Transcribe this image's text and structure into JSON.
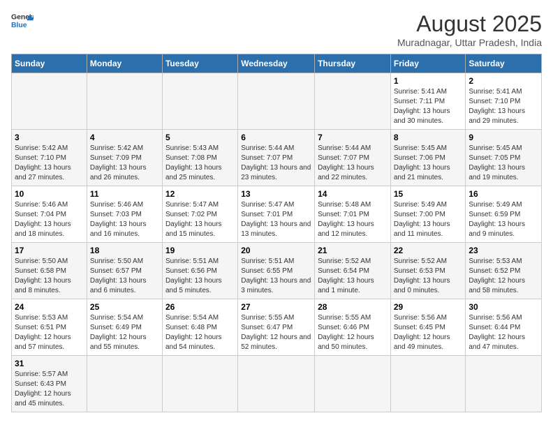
{
  "header": {
    "logo_text_regular": "General",
    "logo_text_colored": "Blue",
    "main_title": "August 2025",
    "subtitle": "Muradnagar, Uttar Pradesh, India"
  },
  "columns": [
    "Sunday",
    "Monday",
    "Tuesday",
    "Wednesday",
    "Thursday",
    "Friday",
    "Saturday"
  ],
  "weeks": [
    [
      {
        "day": "",
        "info": ""
      },
      {
        "day": "",
        "info": ""
      },
      {
        "day": "",
        "info": ""
      },
      {
        "day": "",
        "info": ""
      },
      {
        "day": "",
        "info": ""
      },
      {
        "day": "1",
        "info": "Sunrise: 5:41 AM\nSunset: 7:11 PM\nDaylight: 13 hours and 30 minutes."
      },
      {
        "day": "2",
        "info": "Sunrise: 5:41 AM\nSunset: 7:10 PM\nDaylight: 13 hours and 29 minutes."
      }
    ],
    [
      {
        "day": "3",
        "info": "Sunrise: 5:42 AM\nSunset: 7:10 PM\nDaylight: 13 hours and 27 minutes."
      },
      {
        "day": "4",
        "info": "Sunrise: 5:42 AM\nSunset: 7:09 PM\nDaylight: 13 hours and 26 minutes."
      },
      {
        "day": "5",
        "info": "Sunrise: 5:43 AM\nSunset: 7:08 PM\nDaylight: 13 hours and 25 minutes."
      },
      {
        "day": "6",
        "info": "Sunrise: 5:44 AM\nSunset: 7:07 PM\nDaylight: 13 hours and 23 minutes."
      },
      {
        "day": "7",
        "info": "Sunrise: 5:44 AM\nSunset: 7:07 PM\nDaylight: 13 hours and 22 minutes."
      },
      {
        "day": "8",
        "info": "Sunrise: 5:45 AM\nSunset: 7:06 PM\nDaylight: 13 hours and 21 minutes."
      },
      {
        "day": "9",
        "info": "Sunrise: 5:45 AM\nSunset: 7:05 PM\nDaylight: 13 hours and 19 minutes."
      }
    ],
    [
      {
        "day": "10",
        "info": "Sunrise: 5:46 AM\nSunset: 7:04 PM\nDaylight: 13 hours and 18 minutes."
      },
      {
        "day": "11",
        "info": "Sunrise: 5:46 AM\nSunset: 7:03 PM\nDaylight: 13 hours and 16 minutes."
      },
      {
        "day": "12",
        "info": "Sunrise: 5:47 AM\nSunset: 7:02 PM\nDaylight: 13 hours and 15 minutes."
      },
      {
        "day": "13",
        "info": "Sunrise: 5:47 AM\nSunset: 7:01 PM\nDaylight: 13 hours and 13 minutes."
      },
      {
        "day": "14",
        "info": "Sunrise: 5:48 AM\nSunset: 7:01 PM\nDaylight: 13 hours and 12 minutes."
      },
      {
        "day": "15",
        "info": "Sunrise: 5:49 AM\nSunset: 7:00 PM\nDaylight: 13 hours and 11 minutes."
      },
      {
        "day": "16",
        "info": "Sunrise: 5:49 AM\nSunset: 6:59 PM\nDaylight: 13 hours and 9 minutes."
      }
    ],
    [
      {
        "day": "17",
        "info": "Sunrise: 5:50 AM\nSunset: 6:58 PM\nDaylight: 13 hours and 8 minutes."
      },
      {
        "day": "18",
        "info": "Sunrise: 5:50 AM\nSunset: 6:57 PM\nDaylight: 13 hours and 6 minutes."
      },
      {
        "day": "19",
        "info": "Sunrise: 5:51 AM\nSunset: 6:56 PM\nDaylight: 13 hours and 5 minutes."
      },
      {
        "day": "20",
        "info": "Sunrise: 5:51 AM\nSunset: 6:55 PM\nDaylight: 13 hours and 3 minutes."
      },
      {
        "day": "21",
        "info": "Sunrise: 5:52 AM\nSunset: 6:54 PM\nDaylight: 13 hours and 1 minute."
      },
      {
        "day": "22",
        "info": "Sunrise: 5:52 AM\nSunset: 6:53 PM\nDaylight: 13 hours and 0 minutes."
      },
      {
        "day": "23",
        "info": "Sunrise: 5:53 AM\nSunset: 6:52 PM\nDaylight: 12 hours and 58 minutes."
      }
    ],
    [
      {
        "day": "24",
        "info": "Sunrise: 5:53 AM\nSunset: 6:51 PM\nDaylight: 12 hours and 57 minutes."
      },
      {
        "day": "25",
        "info": "Sunrise: 5:54 AM\nSunset: 6:49 PM\nDaylight: 12 hours and 55 minutes."
      },
      {
        "day": "26",
        "info": "Sunrise: 5:54 AM\nSunset: 6:48 PM\nDaylight: 12 hours and 54 minutes."
      },
      {
        "day": "27",
        "info": "Sunrise: 5:55 AM\nSunset: 6:47 PM\nDaylight: 12 hours and 52 minutes."
      },
      {
        "day": "28",
        "info": "Sunrise: 5:55 AM\nSunset: 6:46 PM\nDaylight: 12 hours and 50 minutes."
      },
      {
        "day": "29",
        "info": "Sunrise: 5:56 AM\nSunset: 6:45 PM\nDaylight: 12 hours and 49 minutes."
      },
      {
        "day": "30",
        "info": "Sunrise: 5:56 AM\nSunset: 6:44 PM\nDaylight: 12 hours and 47 minutes."
      }
    ],
    [
      {
        "day": "31",
        "info": "Sunrise: 5:57 AM\nSunset: 6:43 PM\nDaylight: 12 hours and 45 minutes."
      },
      {
        "day": "",
        "info": ""
      },
      {
        "day": "",
        "info": ""
      },
      {
        "day": "",
        "info": ""
      },
      {
        "day": "",
        "info": ""
      },
      {
        "day": "",
        "info": ""
      },
      {
        "day": "",
        "info": ""
      }
    ]
  ]
}
